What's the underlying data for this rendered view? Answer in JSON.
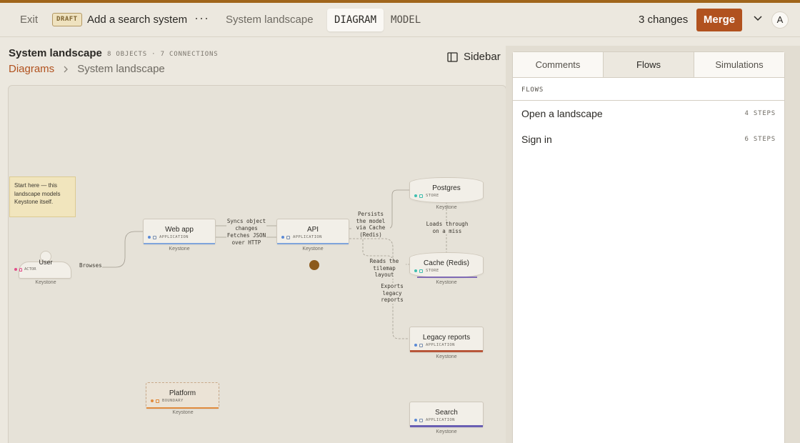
{
  "header": {
    "exit_label": "Exit",
    "draft_badge": "DRAFT",
    "branch_name": "Add a search system",
    "more_label": "···",
    "current_diagram": "System landscape",
    "mode_tabs": [
      {
        "label": "DIAGRAM",
        "active": true
      },
      {
        "label": "MODEL",
        "active": false
      }
    ],
    "changes_label": "3 changes",
    "merge_label": "Merge",
    "avatar_initial": "A"
  },
  "page": {
    "title": "System landscape",
    "meta": "8 OBJECTS · 7 CONNECTIONS",
    "breadcrumb": {
      "root": "Diagrams",
      "current": "System landscape"
    },
    "sidebar_label": "Sidebar"
  },
  "diagram": {
    "note": "Start here — this landscape models Keystone itself.",
    "nodes": {
      "user": {
        "name": "User",
        "type": "ACTOR",
        "owner": "Keystone"
      },
      "webapp": {
        "name": "Web app",
        "type": "APPLICATION",
        "owner": "Keystone"
      },
      "api": {
        "name": "API",
        "type": "APPLICATION",
        "owner": "Keystone"
      },
      "postgres": {
        "name": "Postgres",
        "type": "STORE",
        "owner": "Keystone"
      },
      "cache": {
        "name": "Cache (Redis)",
        "type": "STORE",
        "owner": "Keystone"
      },
      "legacy": {
        "name": "Legacy reports",
        "type": "APPLICATION",
        "owner": "Keystone"
      },
      "platform": {
        "name": "Platform",
        "type": "BOUNDARY",
        "owner": "Keystone"
      },
      "search": {
        "name": "Search",
        "type": "APPLICATION",
        "owner": "Keystone"
      }
    },
    "edges": {
      "browses": "Browses",
      "syncs": "Syncs object changes",
      "fetches": "Fetches JSON over HTTP",
      "persists": "Persists the model via Cache (Redis)",
      "loads": "Loads through on a miss",
      "reads": "Reads the tilemap layout",
      "exports": "Exports legacy reports"
    },
    "colors": {
      "actor": "#e0508a",
      "application": "#5b8ad6",
      "store": "#3fbfb0",
      "boundary": "#e08a3c",
      "cursor": "#8c5a1c"
    }
  },
  "panel": {
    "tabs": [
      {
        "label": "Comments",
        "active": false
      },
      {
        "label": "Flows",
        "active": true
      },
      {
        "label": "Simulations",
        "active": false
      }
    ],
    "section_title": "FLOWS",
    "flows": [
      {
        "name": "Open a landscape",
        "steps": "4 STEPS"
      },
      {
        "name": "Sign in",
        "steps": "6 STEPS"
      }
    ]
  }
}
